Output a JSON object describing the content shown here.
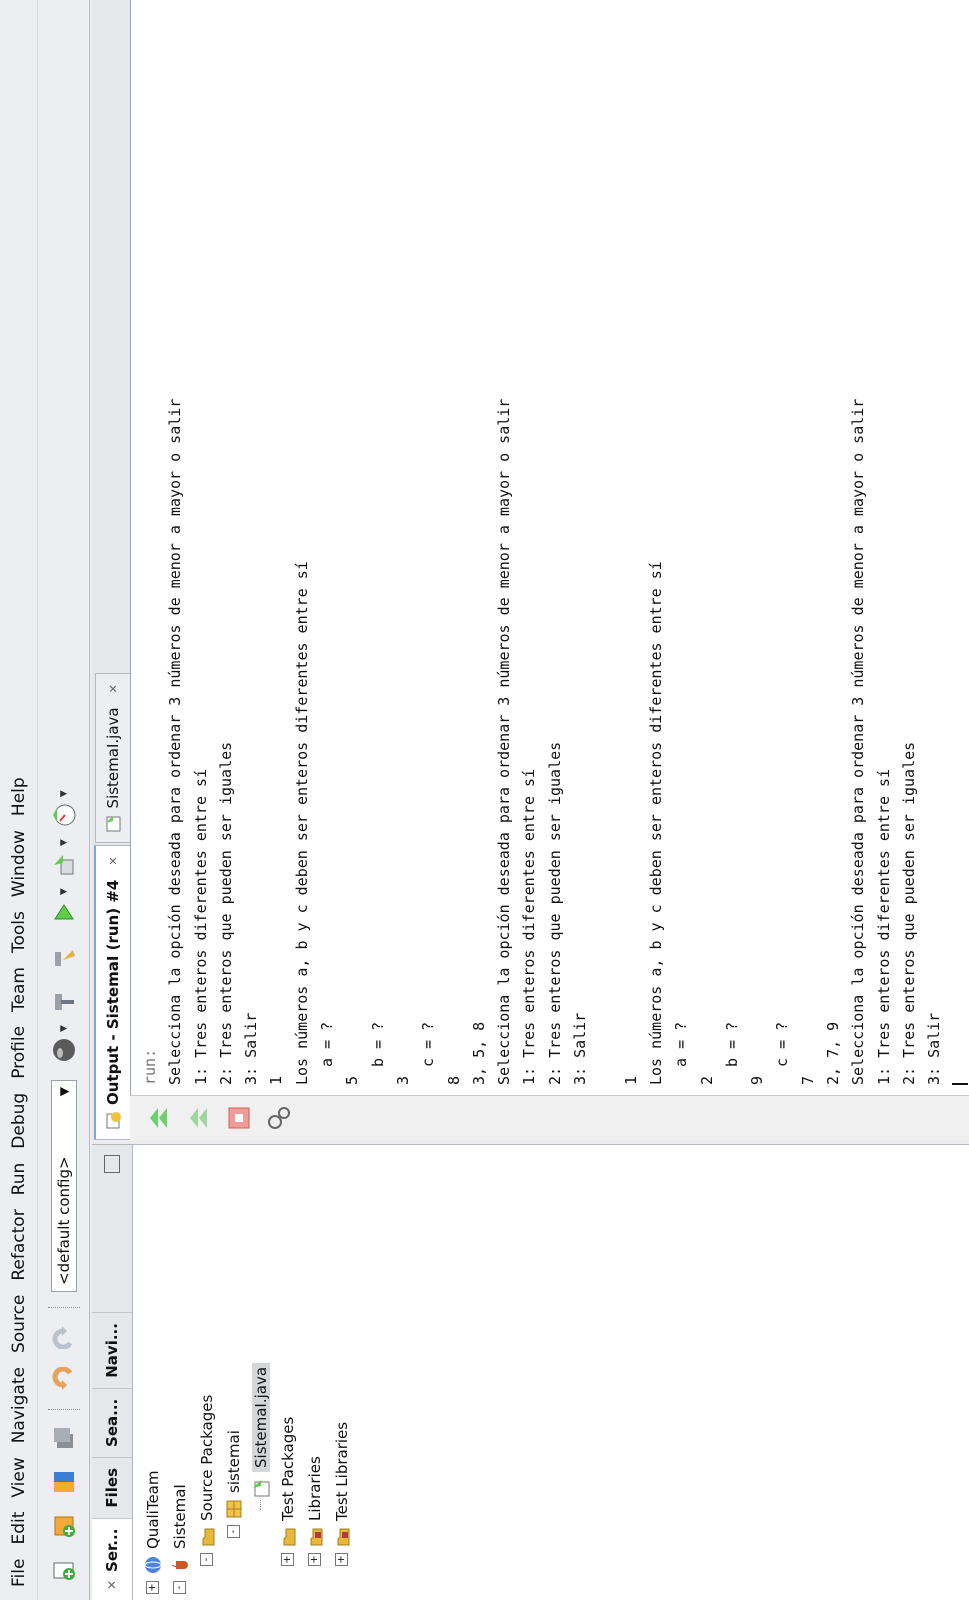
{
  "menu": [
    "File",
    "Edit",
    "View",
    "Navigate",
    "Source",
    "Refactor",
    "Run",
    "Debug",
    "Profile",
    "Team",
    "Tools",
    "Window",
    "Help"
  ],
  "toolbar": {
    "config": "<default config>"
  },
  "left_tabs": [
    {
      "label": "Ser..."
    },
    {
      "label": "Files"
    },
    {
      "label": "Sea..."
    },
    {
      "label": "Navi..."
    }
  ],
  "tree": [
    {
      "label": "QualiTeam",
      "level": 0,
      "expander": "+",
      "icon": "globe-icon"
    },
    {
      "label": "SistemaI",
      "level": 0,
      "expander": "-",
      "icon": "java-project-icon"
    },
    {
      "label": "Source Packages",
      "level": 1,
      "expander": "-",
      "icon": "folder-icon"
    },
    {
      "label": "sistemai",
      "level": 2,
      "expander": "-",
      "icon": "package-icon"
    },
    {
      "label": "SistemaI.java",
      "level": 3,
      "expander": "",
      "icon": "java-file-icon",
      "selected": true
    },
    {
      "label": "Test Packages",
      "level": 1,
      "expander": "+",
      "icon": "folder-icon"
    },
    {
      "label": "Libraries",
      "level": 1,
      "expander": "+",
      "icon": "library-icon"
    },
    {
      "label": "Test Libraries",
      "level": 1,
      "expander": "+",
      "icon": "library-icon"
    }
  ],
  "output_tabs": [
    {
      "label": "Output - SistemaI (run) #4",
      "active": true
    },
    {
      "label": "SistemaI.java",
      "active": false
    }
  ],
  "console_lines": [
    "run:",
    "Selecciona la opción deseada para ordenar 3 números de menor a mayor o salir",
    "1: Tres enteros diferentes entre sí",
    "2: Tres enteros que pueden ser iguales",
    "3: Salir",
    "1",
    "Los números a, b y c deben ser enteros diferentes entre sí",
    "  a = ?",
    "5",
    "  b = ?",
    "3",
    "  c = ?",
    "8",
    "3, 5, 8",
    "Selecciona la opción deseada para ordenar 3 números de menor a mayor o salir",
    "1: Tres enteros diferentes entre sí",
    "2: Tres enteros que pueden ser iguales",
    "3: Salir",
    "",
    "1",
    "Los números a, b y c deben ser enteros diferentes entre sí",
    "  a = ?",
    "2",
    "  b = ?",
    "9",
    "  c = ?",
    "7",
    "2, 7, 9",
    "Selecciona la opción deseada para ordenar 3 números de menor a mayor o salir",
    "1: Tres enteros diferentes entre sí",
    "2: Tres enteros que pueden ser iguales",
    "3: Salir"
  ]
}
